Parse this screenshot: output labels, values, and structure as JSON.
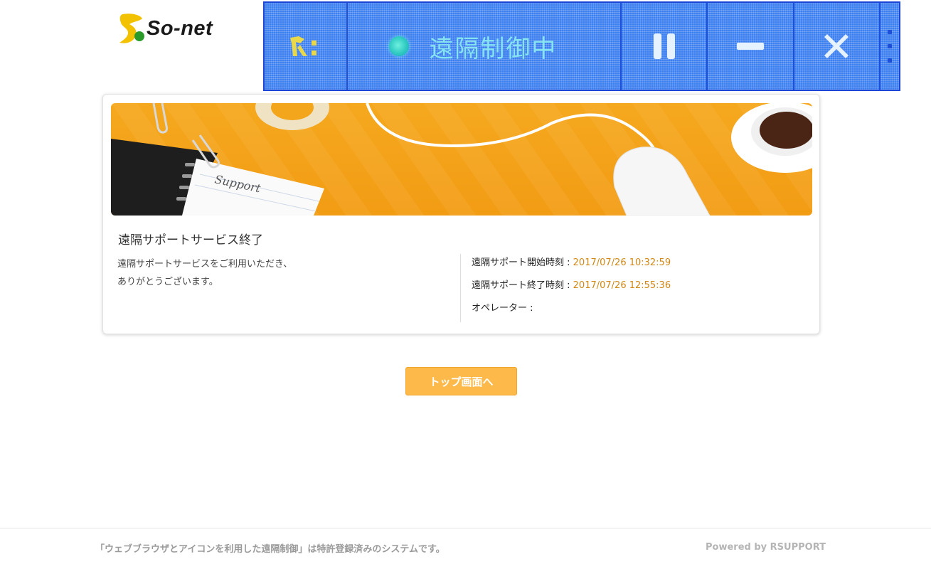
{
  "logo": {
    "text": "So-net"
  },
  "toolbar": {
    "status_label": "遠隔制御中",
    "icons": [
      "rsupport-logo-icon",
      "status-dot-icon",
      "pause-icon",
      "minimize-icon",
      "close-icon",
      "grip-icon"
    ],
    "colors": {
      "background": "#3c7ff0",
      "border": "#1b45d6",
      "status_text": "#86e3f0"
    }
  },
  "banner": {
    "notebook_text": "Support"
  },
  "card": {
    "title": "遠隔サポートサービス終了",
    "message_line1": "遠隔サポートサービスをご利用いただき、",
    "message_line2": "ありがとうございます。",
    "start_label": "遠隔サポート開始時刻 : ",
    "start_value": "2017/07/26 10:32:59",
    "end_label": "遠隔サポート終了時刻 : ",
    "end_value": "2017/07/26 12:55:36",
    "operator_label": "オペレーター :",
    "operator_value": ""
  },
  "button": {
    "label": "トップ画面へ"
  },
  "footer": {
    "left_text": "「ウェブブラウザとアイコンを利用した遠隔制御」は特許登録済みのシステムです。",
    "right_text": "Powered by RSUPPORT"
  },
  "colors": {
    "accent_orange": "#fdb94a",
    "value_orange": "#d08713"
  }
}
